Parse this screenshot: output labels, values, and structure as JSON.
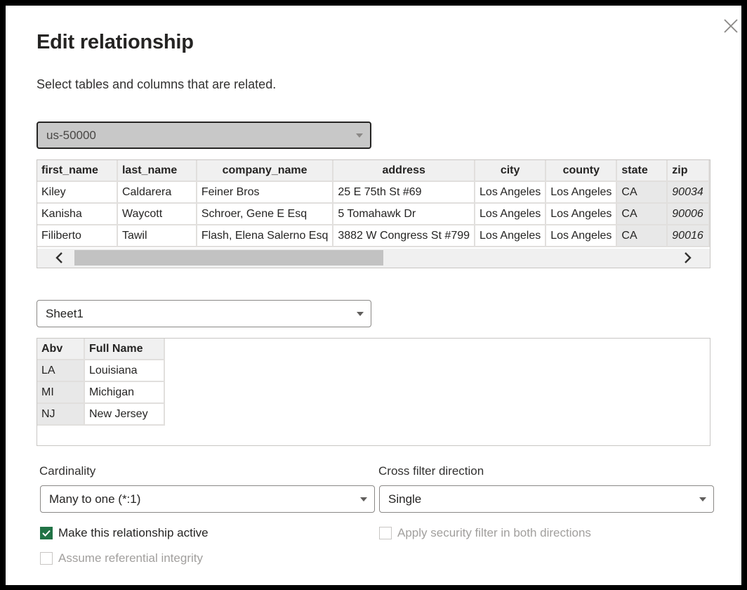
{
  "dialog": {
    "title": "Edit relationship",
    "subtitle": "Select tables and columns that are related."
  },
  "table1": {
    "selected": "us-50000",
    "headers": [
      "first_name",
      "last_name",
      "company_name",
      "address",
      "city",
      "county",
      "state",
      "zip"
    ],
    "rows": [
      [
        "Kiley",
        "Caldarera",
        "Feiner Bros",
        "25 E 75th St #69",
        "Los Angeles",
        "Los Angeles",
        "CA",
        "90034"
      ],
      [
        "Kanisha",
        "Waycott",
        "Schroer, Gene E Esq",
        "5 Tomahawk Dr",
        "Los Angeles",
        "Los Angeles",
        "CA",
        "90006"
      ],
      [
        "Filiberto",
        "Tawil",
        "Flash, Elena Salerno Esq",
        "3882 W Congress St #799",
        "Los Angeles",
        "Los Angeles",
        "CA",
        "90016"
      ]
    ]
  },
  "table2": {
    "selected": "Sheet1",
    "headers": [
      "Abv",
      "Full Name"
    ],
    "rows": [
      [
        "LA",
        "Louisiana"
      ],
      [
        "MI",
        "Michigan"
      ],
      [
        "NJ",
        "New Jersey"
      ]
    ]
  },
  "cardinality": {
    "label": "Cardinality",
    "value": "Many to one (*:1)"
  },
  "cross_filter": {
    "label": "Cross filter direction",
    "value": "Single"
  },
  "options": {
    "make_active": {
      "label": "Make this relationship active",
      "checked": true
    },
    "referential_integrity": {
      "label": "Assume referential integrity",
      "checked": false
    },
    "security_filter": {
      "label": "Apply security filter in both directions",
      "checked": false
    }
  },
  "colors": {
    "accent": "#217346",
    "disabled_text": "#a19f9d"
  },
  "icons": {
    "close": "close-icon",
    "dropdown": "chevron-down-icon",
    "scroll_left": "chevron-left-icon",
    "scroll_right": "chevron-right-icon",
    "check": "checkmark-icon"
  }
}
